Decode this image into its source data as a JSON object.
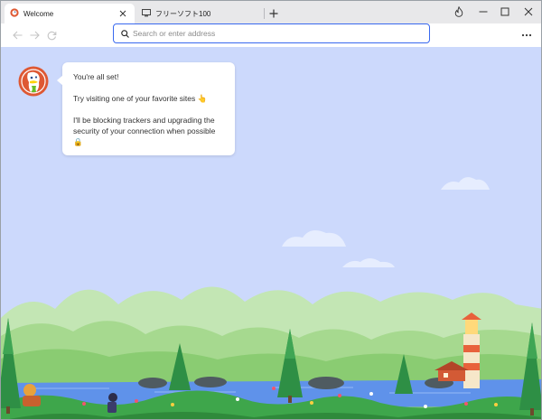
{
  "tabs": [
    {
      "label": "Welcome",
      "active": true,
      "icon": "duckduckgo-icon"
    },
    {
      "label": "フリーソフト100",
      "active": false,
      "icon": "monitor-icon"
    }
  ],
  "window_controls": {
    "fire_icon": "fire-icon",
    "minimize": "minimize-icon",
    "maximize": "maximize-icon",
    "close": "close-icon"
  },
  "toolbar": {
    "address_placeholder": "Search or enter address",
    "address_value": "",
    "search_icon": "search-icon",
    "menu_icon": "more-menu-icon"
  },
  "welcome": {
    "line1": "You're all set!",
    "line2": "Try visiting one of your favorite sites 👆",
    "line3": "I'll be blocking trackers and upgrading the security of your connection when possible 🔒"
  },
  "colors": {
    "accent": "#3969ef",
    "sky": "#ccd9fc",
    "brand": "#de5833"
  }
}
